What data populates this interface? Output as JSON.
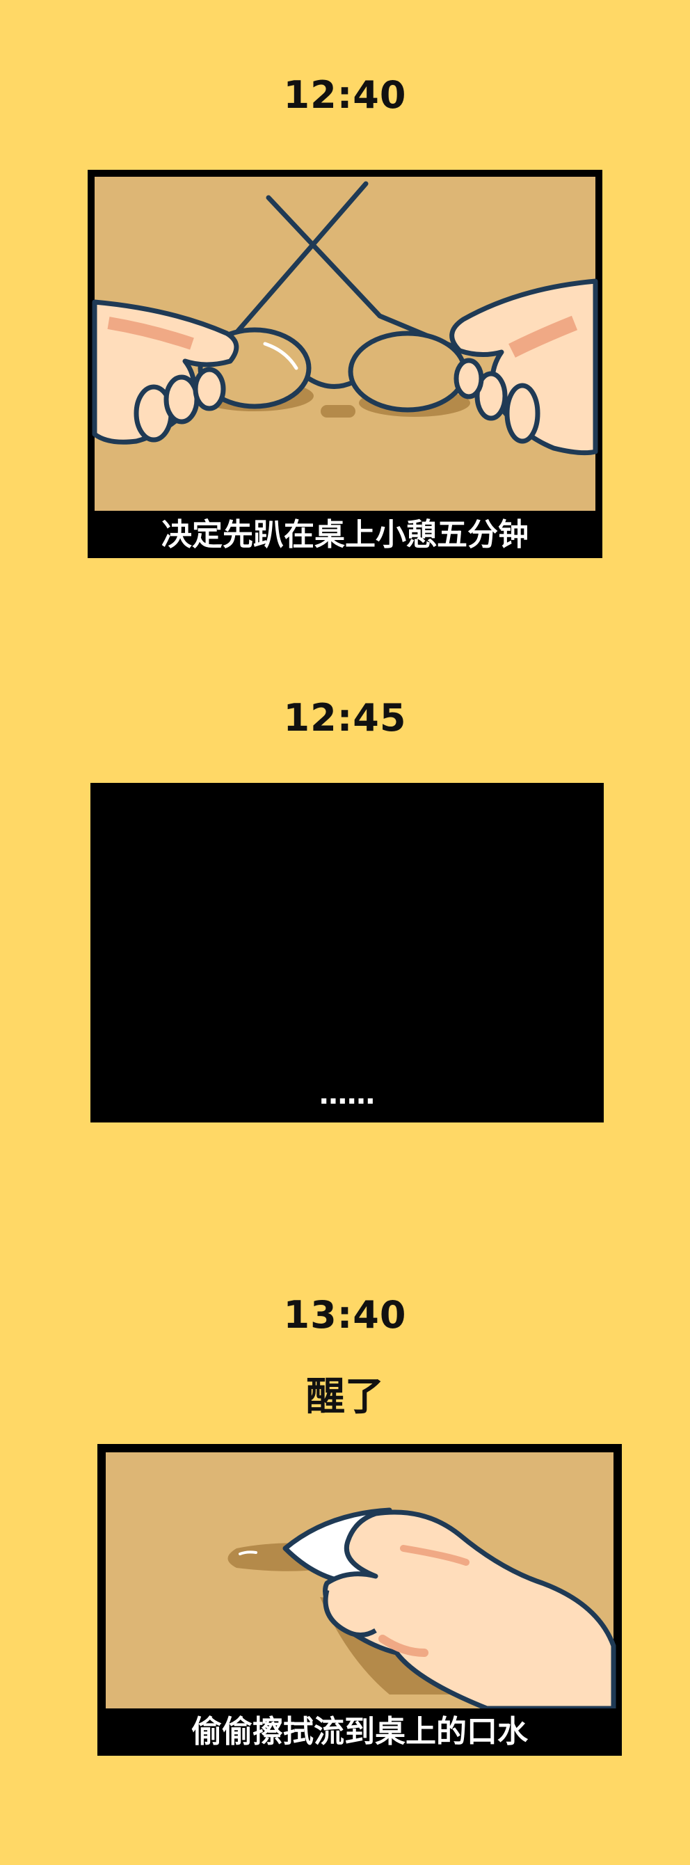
{
  "panels": [
    {
      "time": "12:40",
      "caption": "决定先趴在桌上小憩五分钟"
    },
    {
      "time": "12:45",
      "caption": "……"
    },
    {
      "time": "13:40",
      "subtitle": "醒了",
      "caption": "偷偷擦拭流到桌上的口水"
    }
  ],
  "colors": {
    "background": "#FFD866",
    "desk": "#DDB675",
    "desk_shadow": "#B48A4A",
    "skin": "#FFDDBB",
    "skin_shadow": "#F0A985",
    "outline": "#1F3A55",
    "frame": "#000000"
  }
}
